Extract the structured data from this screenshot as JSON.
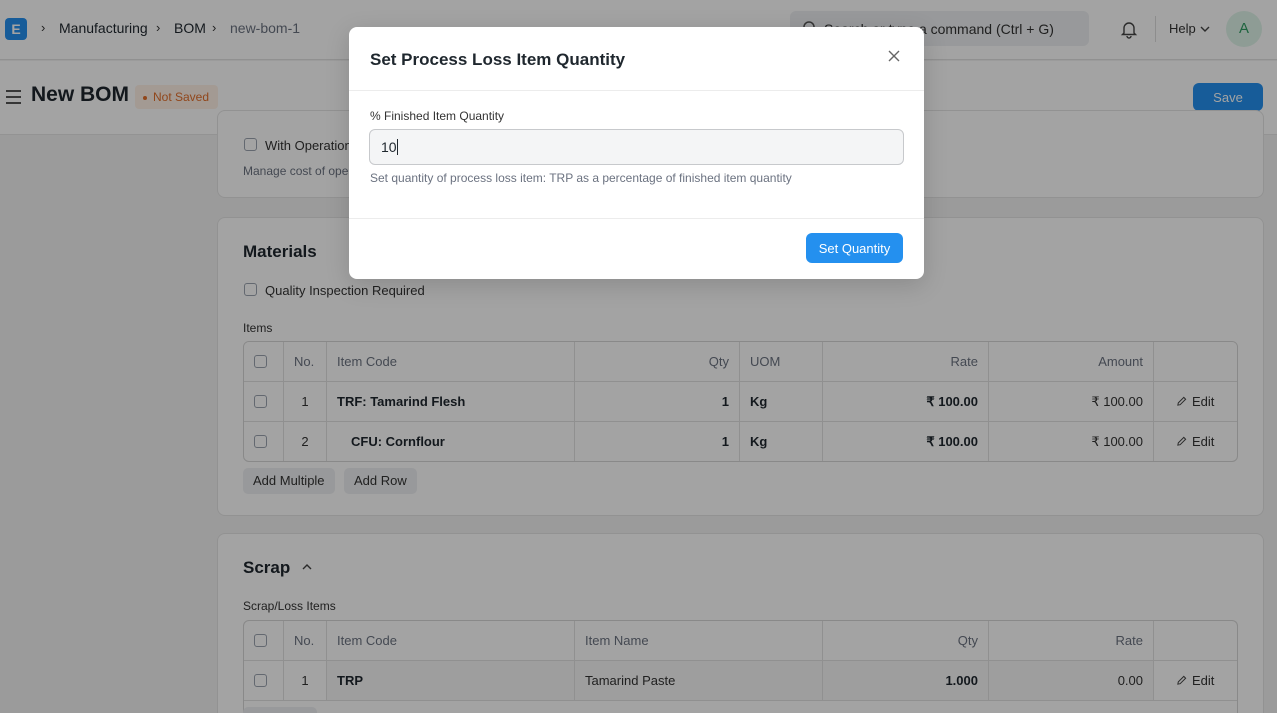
{
  "navbar": {
    "logo": "E",
    "breadcrumbs": [
      "Manufacturing",
      "BOM",
      "new-bom-1"
    ],
    "search_placeholder": "Search or type a command (Ctrl + G)",
    "search_visible": "Search or type a command (Ctrl + G)",
    "help_label": "Help",
    "avatar_initial": "A"
  },
  "page": {
    "title": "New BOM",
    "status_badge": "Not Saved",
    "save_label": "Save"
  },
  "operations": {
    "with_operations_label": "With Operations",
    "description": "Manage cost of operations"
  },
  "materials": {
    "title": "Materials",
    "quality_inspection_label": "Quality Inspection Required",
    "items_label": "Items",
    "columns": [
      "No.",
      "Item Code",
      "Qty",
      "UOM",
      "Rate",
      "Amount"
    ],
    "rows": [
      {
        "no": "1",
        "item_code": "TRF: Tamarind Flesh",
        "qty": "1",
        "uom": "Kg",
        "rate": "₹ 100.00",
        "amount": "₹ 100.00",
        "edit": "Edit"
      },
      {
        "no": "2",
        "item_code": "CFU: Cornflour",
        "qty": "1",
        "uom": "Kg",
        "rate": "₹ 100.00",
        "amount": "₹ 100.00",
        "edit": "Edit"
      }
    ],
    "add_multiple_label": "Add Multiple",
    "add_row_label": "Add Row"
  },
  "scrap": {
    "title": "Scrap",
    "items_label": "Scrap/Loss Items",
    "columns": [
      "No.",
      "Item Code",
      "Item Name",
      "Qty",
      "Rate"
    ],
    "rows": [
      {
        "no": "1",
        "item_code": "TRP",
        "item_name": "Tamarind Paste",
        "qty": "1.000",
        "rate": "0.00",
        "edit": "Edit"
      }
    ]
  },
  "modal": {
    "title": "Set Process Loss Item Quantity",
    "field_label": "% Finished Item Quantity",
    "field_value": "10",
    "field_help": "Set quantity of process loss item: TRP as a percentage of finished item quantity",
    "submit_label": "Set Quantity"
  },
  "colors": {
    "primary": "#2490ef",
    "badge_text": "#e36f2b",
    "badge_bg": "#fff1e7"
  }
}
